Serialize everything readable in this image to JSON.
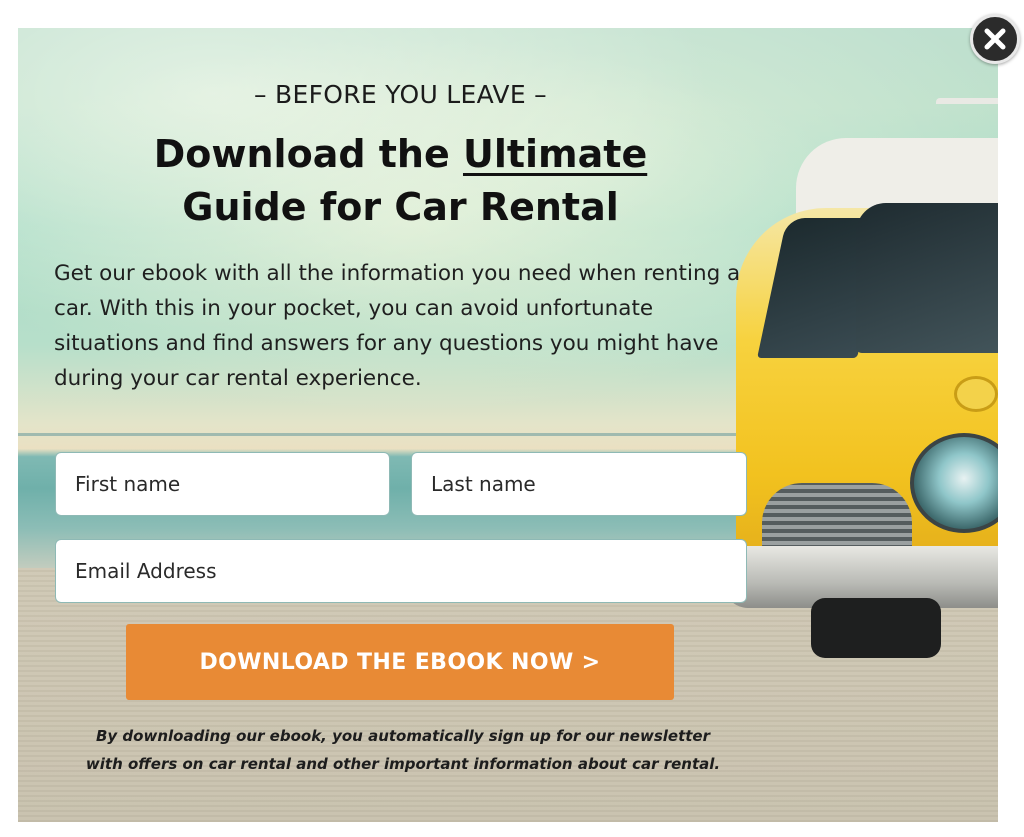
{
  "popup": {
    "pre_title": "– BEFORE YOU LEAVE –",
    "headline": {
      "part1": "Download the ",
      "emphasis": "Ultimate",
      "line2": "Guide for Car Rental"
    },
    "description": "Get our ebook with all the information you need when renting a car. With this in your pocket, you can avoid unfortunate situations and find answers for any questions you might have during your car rental experience.",
    "form": {
      "first_name_placeholder": "First name",
      "last_name_placeholder": "Last name",
      "email_placeholder": "Email Address",
      "submit_label": "DOWNLOAD THE EBOOK NOW >"
    },
    "disclaimer_line1": "By downloading our ebook, you automatically sign up for our newsletter",
    "disclaimer_line2": "with offers on car rental and other important information about car rental."
  },
  "close_icon": "close-icon",
  "colors": {
    "cta": "#e88a35",
    "close_bg": "#2b2b2b"
  }
}
